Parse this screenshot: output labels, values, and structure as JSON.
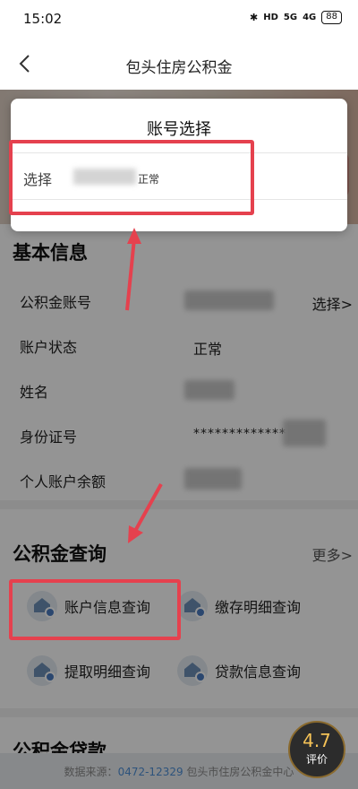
{
  "status_bar": {
    "time": "15:02",
    "bluetooth": "✱",
    "hd": "HD",
    "signal1": "5G",
    "signal2": "4G",
    "battery": "88"
  },
  "header": {
    "title": "包头住房公积金"
  },
  "basic_info": {
    "title": "基本信息",
    "select_link": "选择>",
    "rows": [
      {
        "label": "公积金账号",
        "value": ""
      },
      {
        "label": "账户状态",
        "value": "正常"
      },
      {
        "label": "姓名",
        "value": ""
      },
      {
        "label": "身份证号",
        "value": "*************"
      },
      {
        "label": "个人账户余额",
        "value": ""
      }
    ]
  },
  "query": {
    "title": "公积金查询",
    "more_link": "更多>",
    "services": [
      {
        "label": "账户信息查询"
      },
      {
        "label": "缴存明细查询"
      },
      {
        "label": "提取明细查询"
      },
      {
        "label": "贷款信息查询"
      }
    ]
  },
  "loan_section": {
    "title": "公积金贷款"
  },
  "footer": {
    "prefix": "数据来源：",
    "phone": "0472-12329",
    "suffix": " 包头市住房公积金中心"
  },
  "modal": {
    "title": "账号选择",
    "item_label": "选择",
    "item_status": "正常"
  },
  "rating": {
    "score": "4.7",
    "label": "评价"
  },
  "colors": {
    "highlight": "#e5414e",
    "link": "#4f8fd6"
  }
}
